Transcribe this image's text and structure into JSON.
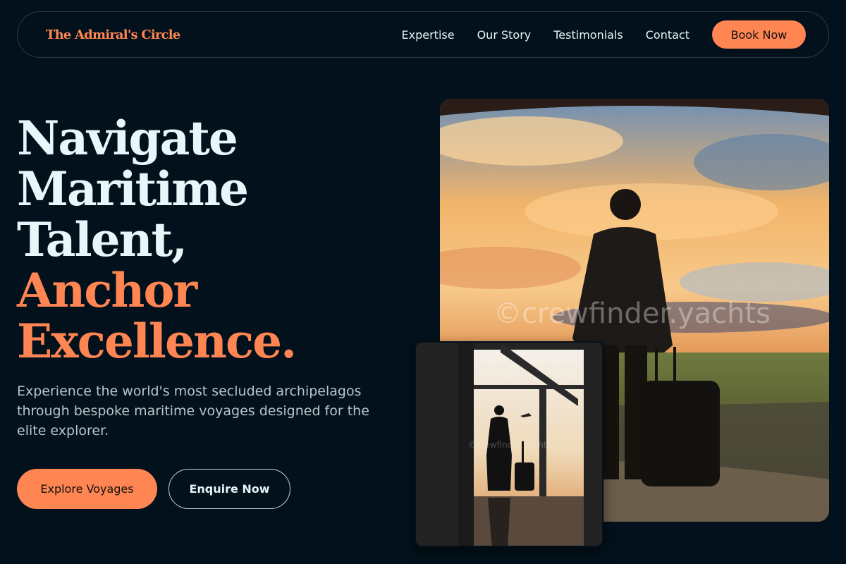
{
  "nav": {
    "logo": "The Admiral's Circle",
    "links": [
      "Expertise",
      "Our Story",
      "Testimonials",
      "Contact"
    ],
    "cta": "Book Now"
  },
  "hero": {
    "lines": [
      "Navigate",
      "Maritime",
      "Talent,"
    ],
    "accent_lines": [
      "Anchor",
      "Excellence."
    ],
    "lede": "Experience the world's most secluded archipelagos through bespoke maritime voyages designed for the elite explorer.",
    "primary_cta": "Explore Voyages",
    "secondary_cta": "Enquire Now"
  },
  "images": {
    "main_watermark": "©crewfinder.yachts",
    "small_watermark": "©crewfinder.yachts"
  },
  "colors": {
    "background": "#02111b",
    "accent": "#ff8552",
    "text": "#e6f7fb"
  }
}
